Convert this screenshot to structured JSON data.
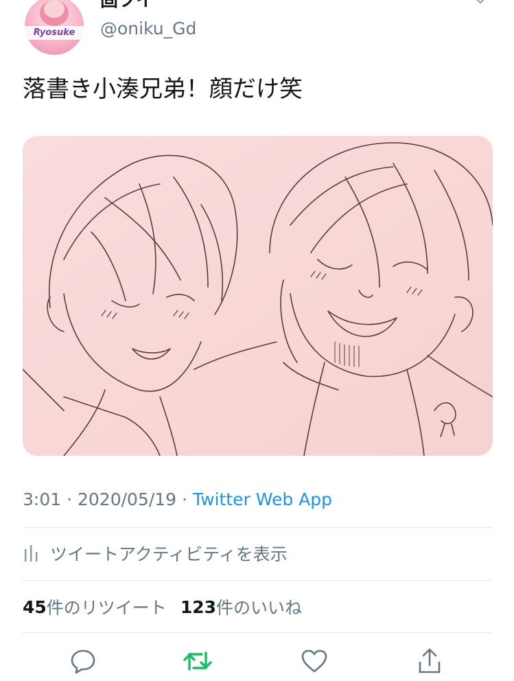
{
  "user": {
    "display_name": "固ツイ",
    "handle": "@oniku_Gd",
    "avatar_label": "Ryosuke"
  },
  "tweet": {
    "text": "落書き小湊兄弟！顔だけ笑",
    "time": "3:01",
    "separator": "·",
    "date": "2020/05/19",
    "source": "Twitter Web App"
  },
  "activity": {
    "label": "ツイートアクティビティを表示",
    "icon": "bar-chart-icon"
  },
  "stats": {
    "retweets_count": "45",
    "retweets_label": "件のリツイート",
    "likes_count": "123",
    "likes_label": "件のいいね"
  },
  "actions": {
    "reply_icon": "speech-bubble-icon",
    "retweet_icon": "retweet-arrows-icon",
    "like_icon": "heart-icon",
    "share_icon": "share-upload-icon"
  },
  "colors": {
    "text": "#14171a",
    "muted": "#657786",
    "link": "#1b95e0",
    "retweet_active": "#17bf63",
    "divider": "#e1e8ed",
    "media_bg": "#f8d8d7",
    "line_art": "#5a3a3a"
  }
}
